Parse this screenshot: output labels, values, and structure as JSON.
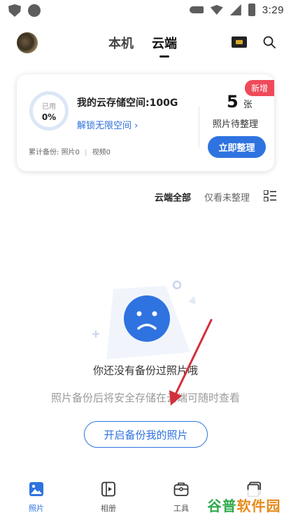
{
  "status_bar": {
    "time": "3:29"
  },
  "header": {
    "tabs": [
      {
        "label": "本机",
        "active": false
      },
      {
        "label": "云端",
        "active": true
      }
    ]
  },
  "storage_card": {
    "usage_label": "已用",
    "usage_value": "0%",
    "title": "我的云存储空间:100G",
    "unlock_link": "解锁无限空间 ›",
    "backup_summary": {
      "prefix": "累计备份:",
      "photos": "照片0",
      "videos": "视频0"
    },
    "new_badge": "新增",
    "pending_count": "5",
    "pending_unit": "张",
    "pending_label": "照片待整理",
    "organize_button": "立即整理"
  },
  "filter": {
    "all": "云端全部",
    "unsorted": "仅看未整理"
  },
  "empty_state": {
    "title": "你还没有备份过照片哦",
    "description": "照片备份后将安全存储在云端可随时查看",
    "button": "开启备份我的照片"
  },
  "bottom_nav": [
    {
      "label": "照片",
      "active": true,
      "icon": "photo-icon"
    },
    {
      "label": "相册",
      "active": false,
      "icon": "album-icon"
    },
    {
      "label": "工具",
      "active": false,
      "icon": "toolbox-icon"
    },
    {
      "label": "",
      "active": false,
      "icon": "files-icon"
    }
  ],
  "watermark": {
    "part_a": "谷普",
    "part_b": "软件园"
  },
  "colors": {
    "accent": "#2f73e0",
    "badge": "#ef4a5a",
    "annotation_arrow": "#d32f3c"
  }
}
